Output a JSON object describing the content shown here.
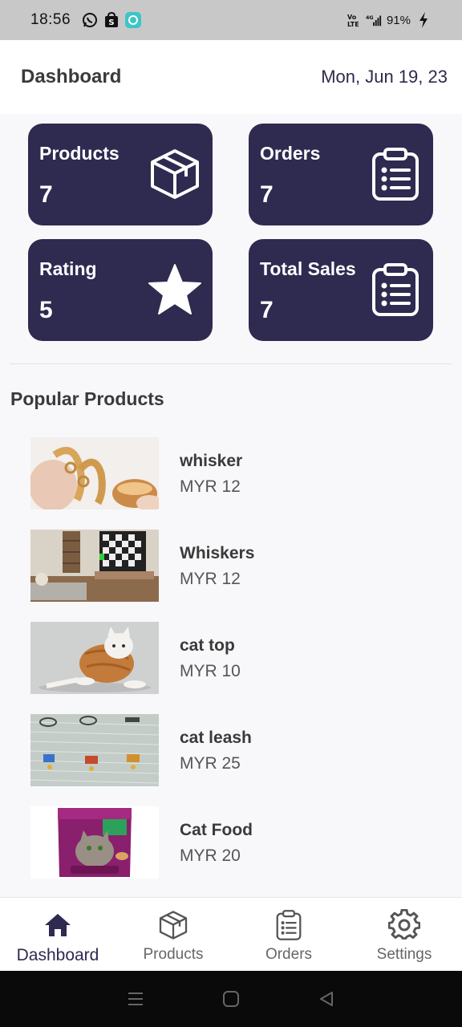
{
  "status_bar": {
    "time": "18:56",
    "battery": "91%"
  },
  "header": {
    "title": "Dashboard",
    "date": "Mon, Jun 19, 23"
  },
  "cards": [
    {
      "label": "Products",
      "value": "7",
      "icon": "box-icon"
    },
    {
      "label": "Orders",
      "value": "7",
      "icon": "clipboard-icon"
    },
    {
      "label": "Rating",
      "value": "5",
      "icon": "star-icon"
    },
    {
      "label": "Total Sales",
      "value": "7",
      "icon": "clipboard-icon"
    }
  ],
  "popular": {
    "title": "Popular Products",
    "items": [
      {
        "name": "whisker",
        "price": "MYR 12"
      },
      {
        "name": "Whiskers",
        "price": "MYR 12"
      },
      {
        "name": "cat top",
        "price": "MYR 10"
      },
      {
        "name": "cat leash",
        "price": "MYR 25"
      },
      {
        "name": "Cat Food",
        "price": "MYR 20"
      }
    ]
  },
  "nav": [
    {
      "label": "Dashboard",
      "icon": "home-icon",
      "active": true
    },
    {
      "label": "Products",
      "icon": "box-icon",
      "active": false
    },
    {
      "label": "Orders",
      "icon": "clipboard-icon",
      "active": false
    },
    {
      "label": "Settings",
      "icon": "gear-icon",
      "active": false
    }
  ],
  "colors": {
    "primary": "#2e2a50",
    "background": "#f8f8fa"
  }
}
